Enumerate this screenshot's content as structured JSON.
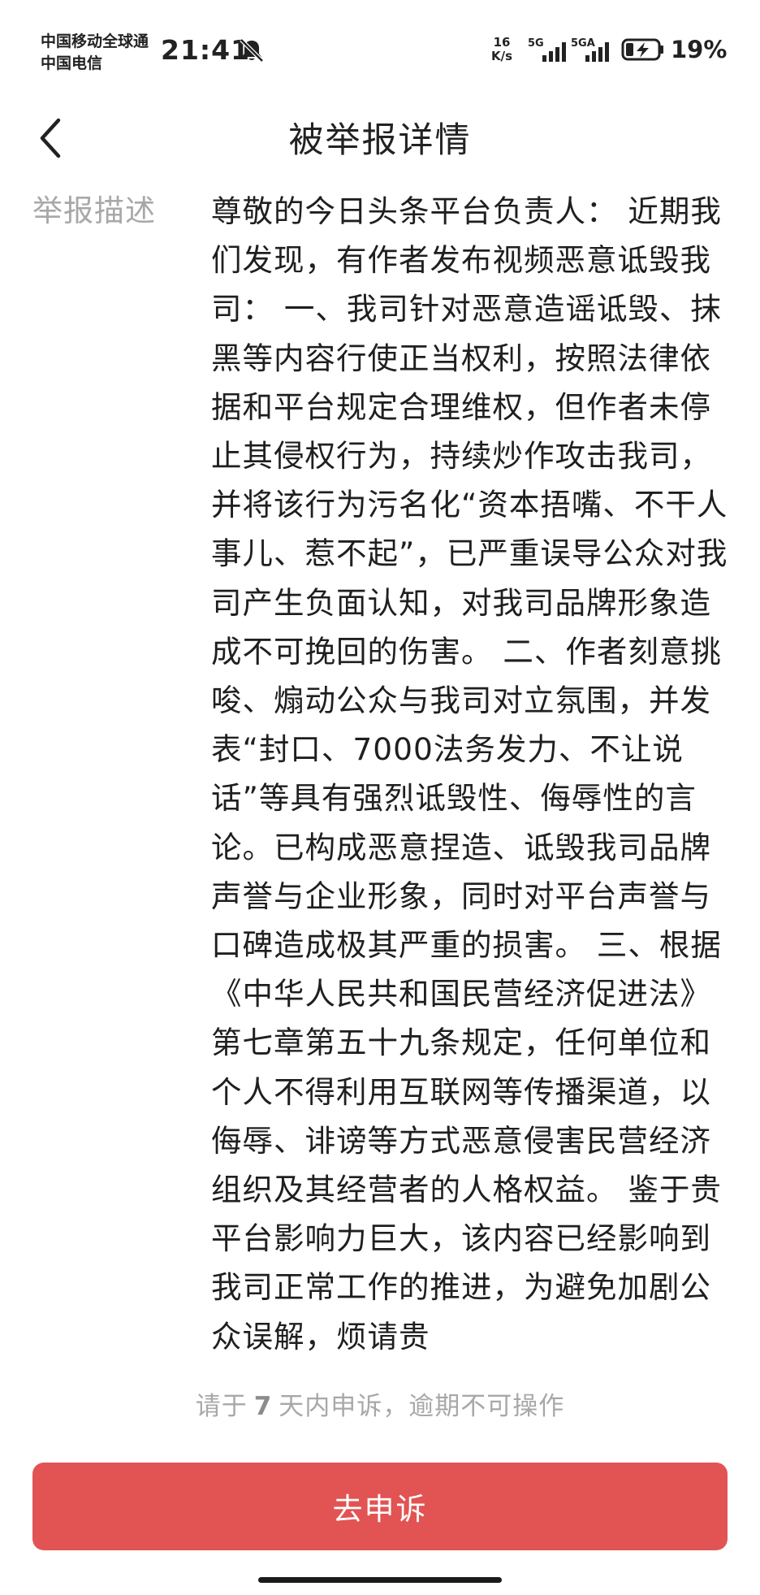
{
  "status_bar": {
    "carrier_1": "中国移动全球通",
    "carrier_2": "中国电信",
    "time": "21:41",
    "net_speed_value": "16",
    "net_speed_unit": "K/s",
    "signal_1_label": "5G",
    "signal_2_label": "5GA",
    "battery_percent": "19%",
    "icons": [
      "bell-off-icon",
      "signal-icon",
      "battery-charging-icon"
    ]
  },
  "header": {
    "back_icon": "chevron-left-icon",
    "title": "被举报详情"
  },
  "report": {
    "label": "举报描述",
    "text": "尊敬的今日头条平台负责人： 近期我们发现，有作者发布视频恶意诋毁我司： 一、我司针对恶意造谣诋毁、抹黑等内容行使正当权利，按照法律依据和平台规定合理维权，但作者未停止其侵权行为，持续炒作攻击我司，并将该行为污名化“资本捂嘴、不干人事儿、惹不起”，已严重误导公众对我司产生负面认知，对我司品牌形象造成不可挽回的伤害。 二、作者刻意挑唆、煽动公众与我司对立氛围，并发表“封口、7000法务发力、不让说话”等具有强烈诋毁性、侮辱性的言论。已构成恶意捏造、诋毁我司品牌声誉与企业形象，同时对平台声誉与口碑造成极其严重的损害。 三、根据《中华人民共和国民营经济促进法》第七章第五十九条规定，任何单位和个人不得利用互联网等传播渠道，以侮辱、诽谤等方式恶意侵害民营经济组织及其经营者的人格权益。 鉴于贵平台影响力巨大，该内容已经影响到我司正常工作的推进，为避免加剧公众误解，烦请贵"
  },
  "appeal": {
    "hint_prefix": "请于",
    "hint_days": "7",
    "hint_suffix": "天内申诉，逾期不可操作",
    "button_label": "去申诉"
  },
  "colors": {
    "accent": "#e25353",
    "muted_text": "#a8a8a8",
    "body_text": "#1f1f1f",
    "background": "#ffffff"
  }
}
